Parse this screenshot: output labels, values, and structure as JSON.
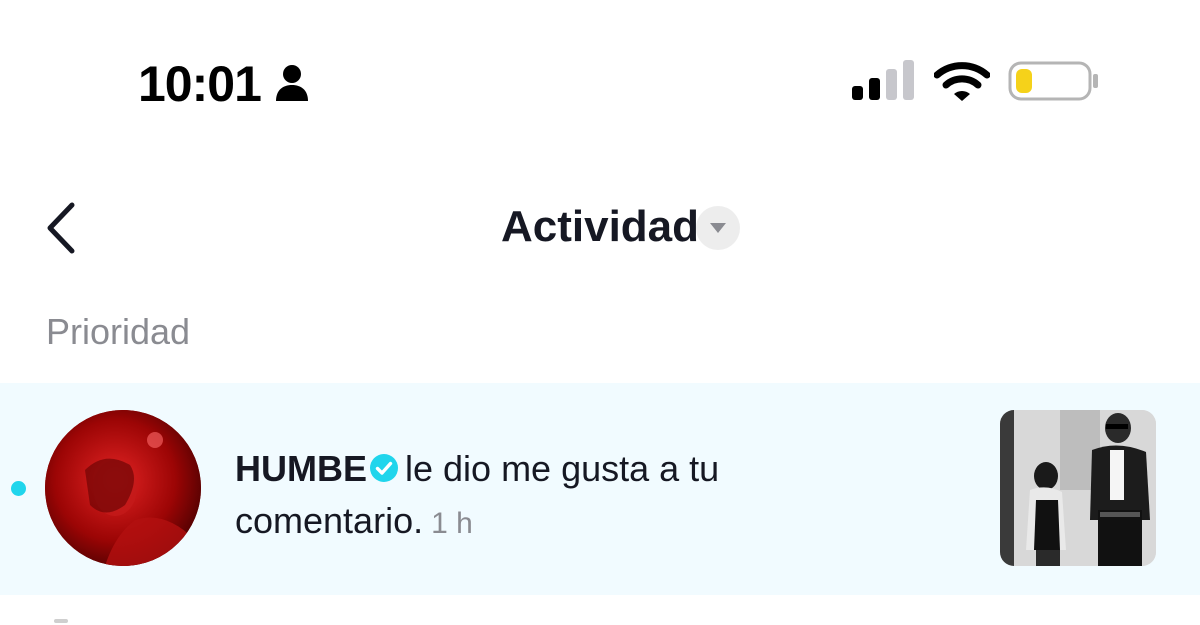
{
  "status_bar": {
    "time": "10:01",
    "icons": [
      "person-icon",
      "signal-icon",
      "wifi-icon",
      "battery-icon"
    ],
    "battery_color": "#f5d21a"
  },
  "header": {
    "title": "Actividad",
    "back_icon": "chevron-left-icon",
    "dropdown_icon": "caret-down-icon"
  },
  "section": {
    "label": "Prioridad"
  },
  "notification": {
    "unread": true,
    "username": "HUMBE",
    "verified": true,
    "message_line1": "le dio me gusta a tu",
    "message_line2": "comentario.",
    "time_ago": "1 h",
    "accent_color": "#20d5ec",
    "row_background": "#f1fbff"
  }
}
